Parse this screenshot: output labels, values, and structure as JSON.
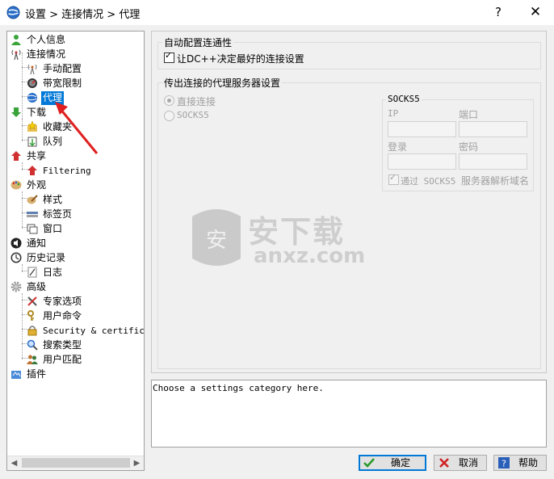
{
  "window": {
    "title": "设置 > 连接情况 > 代理",
    "help_glyph": "?",
    "close_glyph": "✕"
  },
  "tree": {
    "items": [
      {
        "label": "个人信息",
        "icon": "person-icon"
      },
      {
        "label": "连接情况",
        "icon": "antenna-icon"
      },
      {
        "label": "手动配置",
        "icon": "antenna-small-icon"
      },
      {
        "label": "带宽限制",
        "icon": "gauge-icon"
      },
      {
        "label": "代理",
        "icon": "globe-icon"
      },
      {
        "label": "下载",
        "icon": "down-arrow-icon"
      },
      {
        "label": "收藏夹",
        "icon": "star-folder-icon"
      },
      {
        "label": "队列",
        "icon": "queue-icon"
      },
      {
        "label": "共享",
        "icon": "up-arrow-icon"
      },
      {
        "label": "Filtering",
        "icon": "up-arrow-small-icon"
      },
      {
        "label": "外观",
        "icon": "palette-icon"
      },
      {
        "label": "样式",
        "icon": "brush-icon"
      },
      {
        "label": "标签页",
        "icon": "tabs-icon"
      },
      {
        "label": "窗口",
        "icon": "window-icon"
      },
      {
        "label": "通知",
        "icon": "speaker-icon"
      },
      {
        "label": "历史记录",
        "icon": "clock-icon"
      },
      {
        "label": "日志",
        "icon": "log-icon"
      },
      {
        "label": "高级",
        "icon": "gear-icon"
      },
      {
        "label": "专家选项",
        "icon": "tools-icon"
      },
      {
        "label": "用户命令",
        "icon": "key-icon"
      },
      {
        "label": "Security & certificates",
        "icon": "lock-icon"
      },
      {
        "label": "搜索类型",
        "icon": "magnifier-icon"
      },
      {
        "label": "用户匹配",
        "icon": "users-icon"
      },
      {
        "label": "插件",
        "icon": "plugin-icon"
      }
    ],
    "scroll_left": "◀",
    "scroll_right": "▶"
  },
  "auto_config": {
    "group_label": "自动配置连通性",
    "checkbox_label": "让DC++决定最好的连接设置",
    "checked": true
  },
  "proxy": {
    "group_label": "传出连接的代理服务器设置",
    "radio_direct": "直接连接",
    "radio_socks5": "SOCKS5",
    "socks5": {
      "group_label": "SOCKS5",
      "ip_label": "IP",
      "port_label": "端口",
      "login_label": "登录",
      "password_label": "密码",
      "resolve_label_a": "通过 SOCKS5 ",
      "resolve_label_b": "服务器解析域名"
    }
  },
  "status_text": "Choose a settings category here.",
  "buttons": {
    "ok": "确定",
    "cancel": "取消",
    "help": "帮助"
  },
  "watermark": {
    "text": "安下载",
    "sub": "anxz.com"
  },
  "colors": {
    "selection": "#0078d7",
    "annotation_arrow": "#e02020"
  }
}
